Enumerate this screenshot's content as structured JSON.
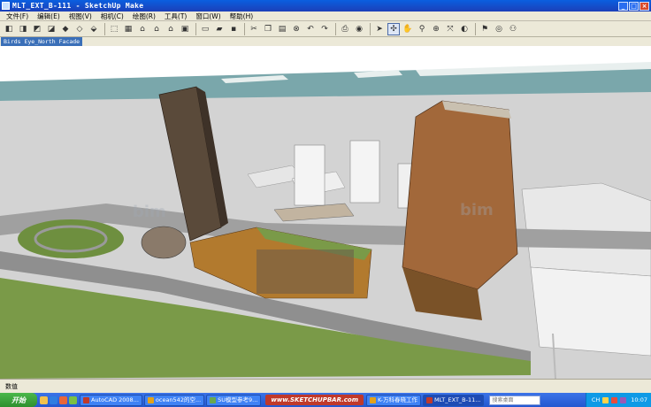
{
  "window": {
    "title": "MLT_EXT_B-111 - SketchUp Make",
    "minimize": "_",
    "maximize": "□",
    "close": "×"
  },
  "menu": {
    "items": [
      "文件(F)",
      "编辑(E)",
      "视图(V)",
      "相机(C)",
      "绘图(R)",
      "工具(T)",
      "窗口(W)",
      "帮助(H)"
    ]
  },
  "toolbar": {
    "icons": [
      "cube-front-icon",
      "cube-back-icon",
      "cube-left-icon",
      "cube-right-icon",
      "cube-top-icon",
      "cube-bottom-icon",
      "cube-iso-icon",
      "sep",
      "wireframe-icon",
      "hidden-line-icon",
      "house-shaded-icon",
      "house-textured-icon",
      "house-outline-icon",
      "house-box-icon",
      "sep",
      "new-file-icon",
      "open-folder-icon",
      "save-icon",
      "sep",
      "cut-icon",
      "copy-icon",
      "paste-icon",
      "erase-icon",
      "undo-icon",
      "redo-icon",
      "sep",
      "print-icon",
      "model-info-icon",
      "sep",
      "select-arrow-icon",
      "orbit-icon",
      "pan-icon",
      "zoom-icon",
      "zoom-window-icon",
      "zoom-extents-icon",
      "previous-view-icon",
      "sep",
      "position-camera-icon",
      "look-around-icon",
      "walk-icon"
    ],
    "glyphs": {
      "cube-front-icon": "◧",
      "cube-back-icon": "◨",
      "cube-left-icon": "◩",
      "cube-right-icon": "◪",
      "cube-top-icon": "◆",
      "cube-bottom-icon": "◇",
      "cube-iso-icon": "⬙",
      "wireframe-icon": "⬚",
      "hidden-line-icon": "▦",
      "house-shaded-icon": "⌂",
      "house-textured-icon": "⌂",
      "house-outline-icon": "⌂",
      "house-box-icon": "▣",
      "new-file-icon": "▭",
      "open-folder-icon": "▰",
      "save-icon": "▪",
      "cut-icon": "✂",
      "copy-icon": "❐",
      "paste-icon": "▤",
      "erase-icon": "⊗",
      "undo-icon": "↶",
      "redo-icon": "↷",
      "print-icon": "⎙",
      "model-info-icon": "◉",
      "select-arrow-icon": "➤",
      "orbit-icon": "✣",
      "pan-icon": "✋",
      "zoom-icon": "⚲",
      "zoom-window-icon": "⊕",
      "zoom-extents-icon": "⤧",
      "previous-view-icon": "◐",
      "position-camera-icon": "⚑",
      "look-around-icon": "◎",
      "walk-icon": "⚇"
    }
  },
  "scene_tab": "Birds Eye_North Facade",
  "status": {
    "text": "数值"
  },
  "taskbar": {
    "start": "开始",
    "tasks": [
      {
        "label": "AutoCAD 2008...",
        "color": "#c0392b"
      },
      {
        "label": "ocean542的空...",
        "color": "#e3a21a"
      },
      {
        "label": "SU模型参考9...",
        "color": "#6aa84f"
      }
    ],
    "banner": "www.SKETCHUPBAR.com",
    "tasks2": [
      {
        "label": "K-万科春晓工作",
        "color": "#e3a21a"
      },
      {
        "label": "MLT_EXT_B-11...",
        "color": "#c0392b",
        "active": true
      }
    ],
    "search_placeholder": "搜索桌面",
    "tray_lang": "CH",
    "clock": "10:07"
  },
  "colors": {
    "sky": "#ffffff",
    "water": "#7aa7ab",
    "ground": "#d3d3d3",
    "road": "#9a9a9a",
    "grass": "#6e8f3f",
    "tower_dark": "#5a4a3a",
    "tower_copper": "#a2683a",
    "podium": "#b27a2e"
  }
}
